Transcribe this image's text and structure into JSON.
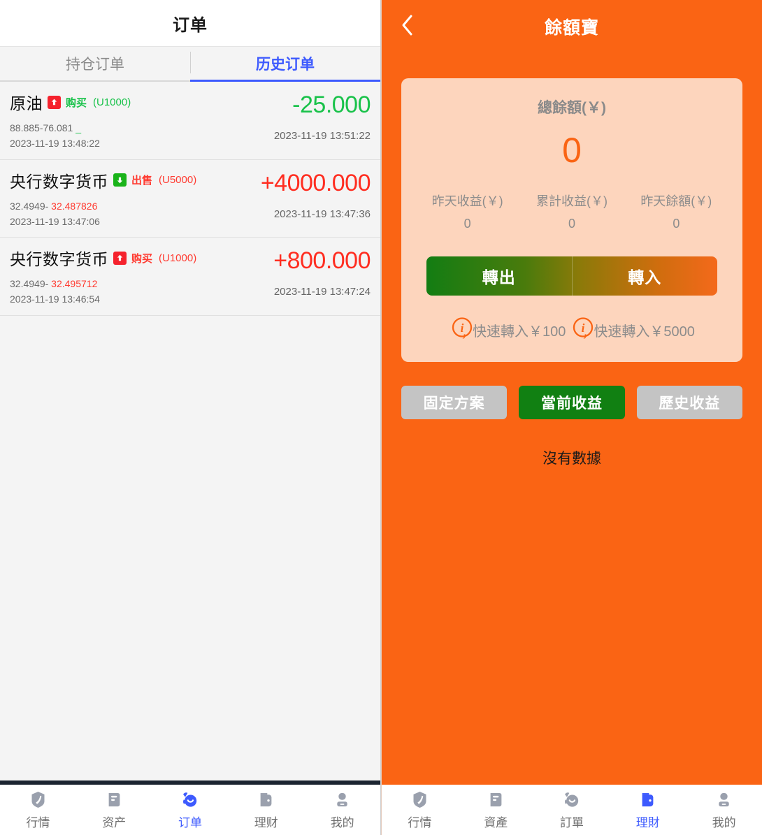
{
  "left": {
    "header": {
      "title": "订单"
    },
    "tabs": [
      {
        "label": "持仓订单",
        "active": false
      },
      {
        "label": "历史订单",
        "active": true
      }
    ],
    "orders": [
      {
        "symbol": "原油",
        "badge_icon": "arrow-up-icon",
        "direction": "up",
        "side": "购买",
        "volume": "(U1000)",
        "side_color": "green",
        "price_open": "88.885-76.081",
        "price_close": "_",
        "price_close_color": "green",
        "time_open": "2023-11-19 13:48:22",
        "amount": "-25.000",
        "amount_color": "green",
        "time_close": "2023-11-19 13:51:22"
      },
      {
        "symbol": "央行数字货币",
        "badge_icon": "arrow-down-icon",
        "direction": "down",
        "side": "出售",
        "volume": "(U5000)",
        "side_color": "red",
        "price_open": "32.4949-",
        "price_close": "32.487826",
        "price_close_color": "red",
        "time_open": "2023-11-19 13:47:06",
        "amount": "+4000.000",
        "amount_color": "red",
        "time_close": "2023-11-19 13:47:36"
      },
      {
        "symbol": "央行数字货币",
        "badge_icon": "arrow-up-icon",
        "direction": "up",
        "side": "购买",
        "volume": "(U1000)",
        "side_color": "red",
        "price_open": "32.4949-",
        "price_close": "32.495712",
        "price_close_color": "red",
        "time_open": "2023-11-19 13:46:54",
        "amount": "+800.000",
        "amount_color": "red",
        "time_close": "2023-11-19 13:47:24"
      }
    ],
    "nav": [
      {
        "label": "行情",
        "icon": "market-badge-icon",
        "active": false
      },
      {
        "label": "资产",
        "icon": "assets-card-icon",
        "active": false
      },
      {
        "label": "订单",
        "icon": "orders-clock-icon",
        "active": true
      },
      {
        "label": "理财",
        "icon": "wallet-icon",
        "active": false
      },
      {
        "label": "我的",
        "icon": "user-icon",
        "active": false
      }
    ]
  },
  "right": {
    "header": {
      "title": "餘額寶",
      "back_icon": "chevron-left-icon"
    },
    "card": {
      "title": "總餘額(￥)",
      "total": "0",
      "stats": [
        {
          "label": "昨天收益(￥)",
          "value": "0"
        },
        {
          "label": "累計收益(￥)",
          "value": "0"
        },
        {
          "label": "昨天餘額(￥)",
          "value": "0"
        }
      ],
      "transfer_out": "轉出",
      "transfer_in": "轉入",
      "quick": [
        {
          "icon": "info-bubble-icon",
          "label": "快速轉入￥100"
        },
        {
          "icon": "info-bubble-icon",
          "label": "快速轉入￥5000"
        }
      ]
    },
    "segments": [
      {
        "label": "固定方案",
        "active": false
      },
      {
        "label": "當前收益",
        "active": true
      },
      {
        "label": "歷史收益",
        "active": false
      }
    ],
    "empty_text": "沒有數據",
    "nav": [
      {
        "label": "行情",
        "icon": "market-badge-icon",
        "active": false
      },
      {
        "label": "資產",
        "icon": "assets-card-icon",
        "active": false
      },
      {
        "label": "訂單",
        "icon": "orders-clock-icon",
        "active": false
      },
      {
        "label": "理財",
        "icon": "wallet-icon",
        "active": true
      },
      {
        "label": "我的",
        "icon": "user-icon",
        "active": false
      }
    ]
  },
  "colors": {
    "orange": "#fa6414",
    "card_peach": "#fdd5bd",
    "accent_blue": "#3d5afe",
    "up_red": "#f5222d",
    "down_green": "#19b319",
    "green_btn": "#118012"
  }
}
